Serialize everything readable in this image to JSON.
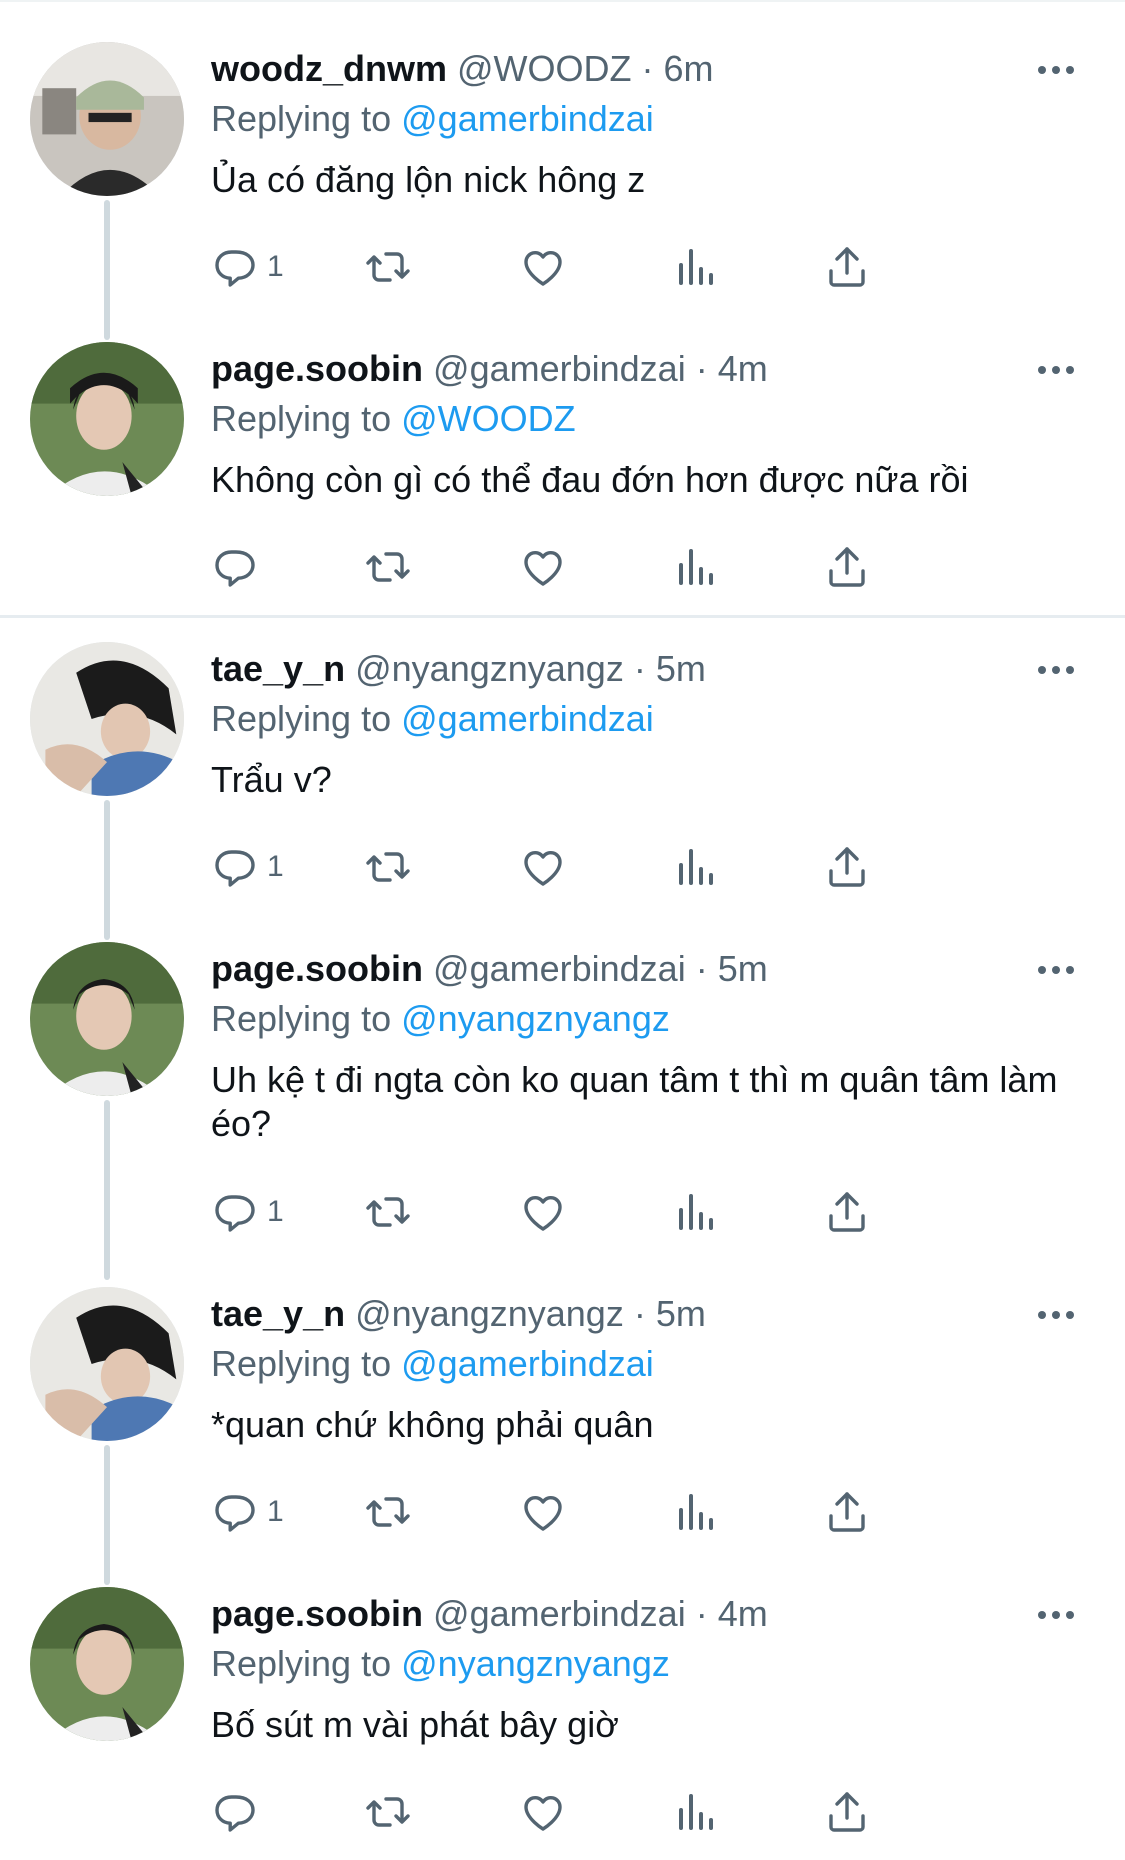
{
  "colors": {
    "link": "#1d9bf0",
    "secondary": "#536471",
    "primary": "#0f1419",
    "divider": "#e6ecf0"
  },
  "tweets": [
    {
      "name": "woodz_dnwm",
      "handle": "@WOODZ",
      "time": "· 6m",
      "replying_prefix": "Replying to",
      "replying_to": "@gamerbindzai",
      "text": "Ủa có đăng lộn nick hông z",
      "reply_count": "1",
      "avatar": "woodz-avatar"
    },
    {
      "name": "page.soobin",
      "handle": "@gamerbindzai",
      "time": "· 4m",
      "replying_prefix": "Replying to",
      "replying_to": "@WOODZ",
      "text": "Không còn gì có thể đau đớn hơn được nữa rồi",
      "reply_count": "",
      "avatar": "soobin-avatar"
    },
    {
      "name": "tae_y_n",
      "handle": "@nyangznyangz",
      "time": "· 5m",
      "replying_prefix": "Replying to",
      "replying_to": "@gamerbindzai",
      "text": "Trẩu v?",
      "reply_count": "1",
      "avatar": "taeyn-avatar"
    },
    {
      "name": "page.soobin",
      "handle": "@gamerbindzai",
      "time": "· 5m",
      "replying_prefix": "Replying to",
      "replying_to": "@nyangznyangz",
      "text": "Uh kệ t đi ngta còn ko quan tâm t thì m quân tâm làm éo?",
      "reply_count": "1",
      "avatar": "soobin-avatar"
    },
    {
      "name": "tae_y_n",
      "handle": "@nyangznyangz",
      "time": "· 5m",
      "replying_prefix": "Replying to",
      "replying_to": "@gamerbindzai",
      "text": "*quan chứ không phải quân",
      "reply_count": "1",
      "avatar": "taeyn-avatar"
    },
    {
      "name": "page.soobin",
      "handle": "@gamerbindzai",
      "time": "· 4m",
      "replying_prefix": "Replying to",
      "replying_to": "@nyangznyangz",
      "text": "Bố sút m vài phát bây giờ",
      "reply_count": "",
      "avatar": "soobin-avatar"
    }
  ],
  "actions": [
    "reply-icon",
    "retweet-icon",
    "like-icon",
    "analytics-icon",
    "share-icon"
  ]
}
